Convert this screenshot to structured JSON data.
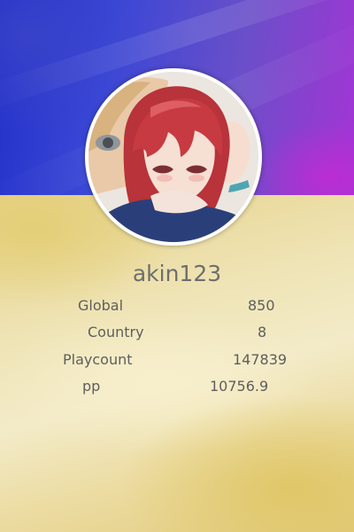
{
  "profile": {
    "username": "akin123",
    "avatar_icon": "anime-avatar-icon"
  },
  "stats": [
    {
      "label": "Global",
      "value": "850"
    },
    {
      "label": "Country",
      "value": "8"
    },
    {
      "label": "Playcount",
      "value": "147839"
    },
    {
      "label": "pp",
      "value": "10756.9"
    }
  ],
  "colors": {
    "banner_left": "#2230c8",
    "banner_right": "#a534d6",
    "card_body": "#eee2b0",
    "text": "#5e5e5e",
    "avatar_ring": "#ffffff"
  }
}
